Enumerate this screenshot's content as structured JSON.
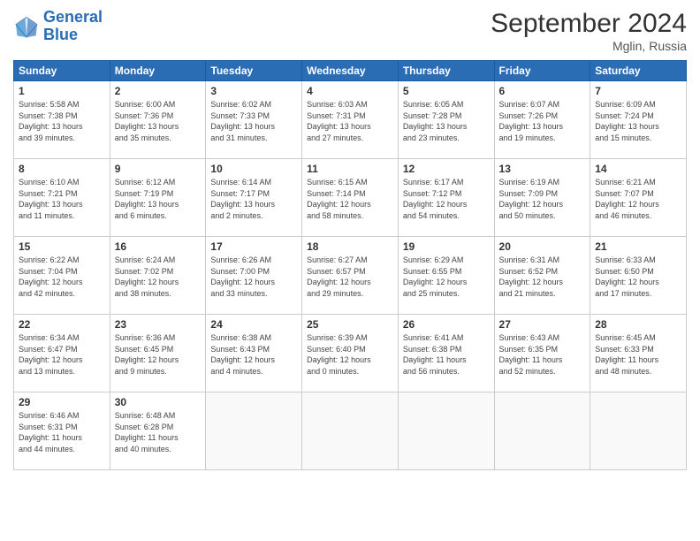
{
  "header": {
    "logo_line1": "General",
    "logo_line2": "Blue",
    "month": "September 2024",
    "location": "Mglin, Russia"
  },
  "weekdays": [
    "Sunday",
    "Monday",
    "Tuesday",
    "Wednesday",
    "Thursday",
    "Friday",
    "Saturday"
  ],
  "weeks": [
    [
      {
        "day": "1",
        "info": "Sunrise: 5:58 AM\nSunset: 7:38 PM\nDaylight: 13 hours\nand 39 minutes."
      },
      {
        "day": "2",
        "info": "Sunrise: 6:00 AM\nSunset: 7:36 PM\nDaylight: 13 hours\nand 35 minutes."
      },
      {
        "day": "3",
        "info": "Sunrise: 6:02 AM\nSunset: 7:33 PM\nDaylight: 13 hours\nand 31 minutes."
      },
      {
        "day": "4",
        "info": "Sunrise: 6:03 AM\nSunset: 7:31 PM\nDaylight: 13 hours\nand 27 minutes."
      },
      {
        "day": "5",
        "info": "Sunrise: 6:05 AM\nSunset: 7:28 PM\nDaylight: 13 hours\nand 23 minutes."
      },
      {
        "day": "6",
        "info": "Sunrise: 6:07 AM\nSunset: 7:26 PM\nDaylight: 13 hours\nand 19 minutes."
      },
      {
        "day": "7",
        "info": "Sunrise: 6:09 AM\nSunset: 7:24 PM\nDaylight: 13 hours\nand 15 minutes."
      }
    ],
    [
      {
        "day": "8",
        "info": "Sunrise: 6:10 AM\nSunset: 7:21 PM\nDaylight: 13 hours\nand 11 minutes."
      },
      {
        "day": "9",
        "info": "Sunrise: 6:12 AM\nSunset: 7:19 PM\nDaylight: 13 hours\nand 6 minutes."
      },
      {
        "day": "10",
        "info": "Sunrise: 6:14 AM\nSunset: 7:17 PM\nDaylight: 13 hours\nand 2 minutes."
      },
      {
        "day": "11",
        "info": "Sunrise: 6:15 AM\nSunset: 7:14 PM\nDaylight: 12 hours\nand 58 minutes."
      },
      {
        "day": "12",
        "info": "Sunrise: 6:17 AM\nSunset: 7:12 PM\nDaylight: 12 hours\nand 54 minutes."
      },
      {
        "day": "13",
        "info": "Sunrise: 6:19 AM\nSunset: 7:09 PM\nDaylight: 12 hours\nand 50 minutes."
      },
      {
        "day": "14",
        "info": "Sunrise: 6:21 AM\nSunset: 7:07 PM\nDaylight: 12 hours\nand 46 minutes."
      }
    ],
    [
      {
        "day": "15",
        "info": "Sunrise: 6:22 AM\nSunset: 7:04 PM\nDaylight: 12 hours\nand 42 minutes."
      },
      {
        "day": "16",
        "info": "Sunrise: 6:24 AM\nSunset: 7:02 PM\nDaylight: 12 hours\nand 38 minutes."
      },
      {
        "day": "17",
        "info": "Sunrise: 6:26 AM\nSunset: 7:00 PM\nDaylight: 12 hours\nand 33 minutes."
      },
      {
        "day": "18",
        "info": "Sunrise: 6:27 AM\nSunset: 6:57 PM\nDaylight: 12 hours\nand 29 minutes."
      },
      {
        "day": "19",
        "info": "Sunrise: 6:29 AM\nSunset: 6:55 PM\nDaylight: 12 hours\nand 25 minutes."
      },
      {
        "day": "20",
        "info": "Sunrise: 6:31 AM\nSunset: 6:52 PM\nDaylight: 12 hours\nand 21 minutes."
      },
      {
        "day": "21",
        "info": "Sunrise: 6:33 AM\nSunset: 6:50 PM\nDaylight: 12 hours\nand 17 minutes."
      }
    ],
    [
      {
        "day": "22",
        "info": "Sunrise: 6:34 AM\nSunset: 6:47 PM\nDaylight: 12 hours\nand 13 minutes."
      },
      {
        "day": "23",
        "info": "Sunrise: 6:36 AM\nSunset: 6:45 PM\nDaylight: 12 hours\nand 9 minutes."
      },
      {
        "day": "24",
        "info": "Sunrise: 6:38 AM\nSunset: 6:43 PM\nDaylight: 12 hours\nand 4 minutes."
      },
      {
        "day": "25",
        "info": "Sunrise: 6:39 AM\nSunset: 6:40 PM\nDaylight: 12 hours\nand 0 minutes."
      },
      {
        "day": "26",
        "info": "Sunrise: 6:41 AM\nSunset: 6:38 PM\nDaylight: 11 hours\nand 56 minutes."
      },
      {
        "day": "27",
        "info": "Sunrise: 6:43 AM\nSunset: 6:35 PM\nDaylight: 11 hours\nand 52 minutes."
      },
      {
        "day": "28",
        "info": "Sunrise: 6:45 AM\nSunset: 6:33 PM\nDaylight: 11 hours\nand 48 minutes."
      }
    ],
    [
      {
        "day": "29",
        "info": "Sunrise: 6:46 AM\nSunset: 6:31 PM\nDaylight: 11 hours\nand 44 minutes."
      },
      {
        "day": "30",
        "info": "Sunrise: 6:48 AM\nSunset: 6:28 PM\nDaylight: 11 hours\nand 40 minutes."
      },
      {
        "day": "",
        "info": ""
      },
      {
        "day": "",
        "info": ""
      },
      {
        "day": "",
        "info": ""
      },
      {
        "day": "",
        "info": ""
      },
      {
        "day": "",
        "info": ""
      }
    ]
  ]
}
